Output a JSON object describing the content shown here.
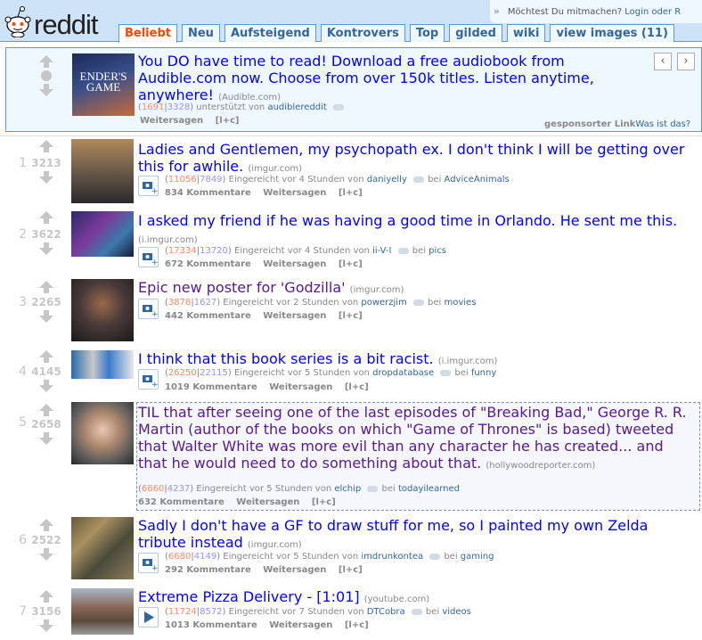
{
  "header": {
    "logo_text": "reddit",
    "tabs": [
      {
        "label": "Beliebt",
        "active": true
      },
      {
        "label": "Neu",
        "active": false
      },
      {
        "label": "Aufsteigend",
        "active": false
      },
      {
        "label": "Kontrovers",
        "active": false
      },
      {
        "label": "Top",
        "active": false
      },
      {
        "label": "gilded",
        "active": false
      },
      {
        "label": "wiki",
        "active": false
      },
      {
        "label": "view images (11)",
        "active": false
      }
    ],
    "user_prompt": "Möchtest Du mitmachen?",
    "login_link": "Login oder R",
    "chevron": "»"
  },
  "sponsored": {
    "title": "You DO have time to read! Download a free audiobook from Audible.com now. Choose from over 150k titles. Listen anytime, anywhere!",
    "domain": "(Audible.com)",
    "ups": "1691",
    "downs": "3328",
    "tagline_mid": "unterstützt von",
    "author": "audiblereddit",
    "share": "Weitersagen",
    "shortcut": "[l+c]",
    "sponsored_label": "gesponsorter Link",
    "whatis": "Was ist das?",
    "prev": "‹",
    "next": "›"
  },
  "posts": [
    {
      "rank": "1",
      "score": "3213",
      "title": "Ladies and Gentlemen, my psychopath ex. I don't think I will be getting over this for awhile.",
      "domain": "(imgur.com)",
      "ups": "11056",
      "downs": "7849",
      "age": "Eingereicht vor 4 Stunden von",
      "author": "daniyelly",
      "bei": "bei",
      "subreddit": "AdviceAnimals",
      "comments": "834 Kommentare",
      "share": "Weitersagen",
      "shortcut": "[l+c]"
    },
    {
      "rank": "2",
      "score": "3622",
      "title": "I asked my friend if he was having a good time in Orlando. He sent me this.",
      "domain": "(i.imgur.com)",
      "ups": "17334",
      "downs": "13720",
      "age": "Eingereicht vor 4 Stunden von",
      "author": "ii-V-I",
      "bei": "bei",
      "subreddit": "pics",
      "comments": "672 Kommentare",
      "share": "Weitersagen",
      "shortcut": "[l+c]"
    },
    {
      "rank": "3",
      "score": "2265",
      "title": "Epic new poster for 'Godzilla'",
      "domain": "(imgur.com)",
      "ups": "3878",
      "downs": "1627",
      "age": "Eingereicht vor 2 Stunden von",
      "author": "powerzjim",
      "bei": "bei",
      "subreddit": "movies",
      "comments": "442 Kommentare",
      "share": "Weitersagen",
      "shortcut": "[l+c]"
    },
    {
      "rank": "4",
      "score": "4145",
      "title": "I think that this book series is a bit racist.",
      "domain": "(i.imgur.com)",
      "ups": "26250",
      "downs": "22115",
      "age": "Eingereicht vor 5 Stunden von",
      "author": "dropdatabase",
      "bei": "bei",
      "subreddit": "funny",
      "comments": "1019 Kommentare",
      "share": "Weitersagen",
      "shortcut": "[l+c]"
    },
    {
      "rank": "5",
      "score": "2658",
      "title": "TIL that after seeing one of the last episodes of \"Breaking Bad,\" George R. R. Martin (author of the books on which \"Game of Thrones\" is based) tweeted that Walter White was more evil than any character he has created... and that he would need to do something about that.",
      "domain": "(hollywoodreporter.com)",
      "ups": "6860",
      "downs": "4237",
      "age": "Eingereicht vor 5 Stunden von",
      "author": "elchip",
      "bei": "bei",
      "subreddit": "todayilearned",
      "comments": "632 Kommentare",
      "share": "Weitersagen",
      "shortcut": "[l+c]"
    },
    {
      "rank": "6",
      "score": "2522",
      "title": "Sadly I don't have a GF to draw stuff for me, so I painted my own Zelda tribute instead",
      "domain": "(imgur.com)",
      "ups": "6680",
      "downs": "4149",
      "age": "Eingereicht vor 5 Stunden von",
      "author": "imdrunkontea",
      "bei": "bei",
      "subreddit": "gaming",
      "comments": "292 Kommentare",
      "share": "Weitersagen",
      "shortcut": "[l+c]"
    },
    {
      "rank": "7",
      "score": "3156",
      "title": "Extreme Pizza Delivery - [1:01]",
      "domain": "(youtube.com)",
      "ups": "11724",
      "downs": "8572",
      "age": "Eingereicht vor 7 Stunden von",
      "author": "DTCobra",
      "bei": "bei",
      "subreddit": "videos",
      "comments": "1013 Kommentare",
      "share": "Weitersagen",
      "shortcut": "[l+c]"
    }
  ],
  "colors": {
    "header_bg": "#cee3f8",
    "link": "#0000ff",
    "visited": "#551a8b",
    "accent": "#ff4500"
  }
}
